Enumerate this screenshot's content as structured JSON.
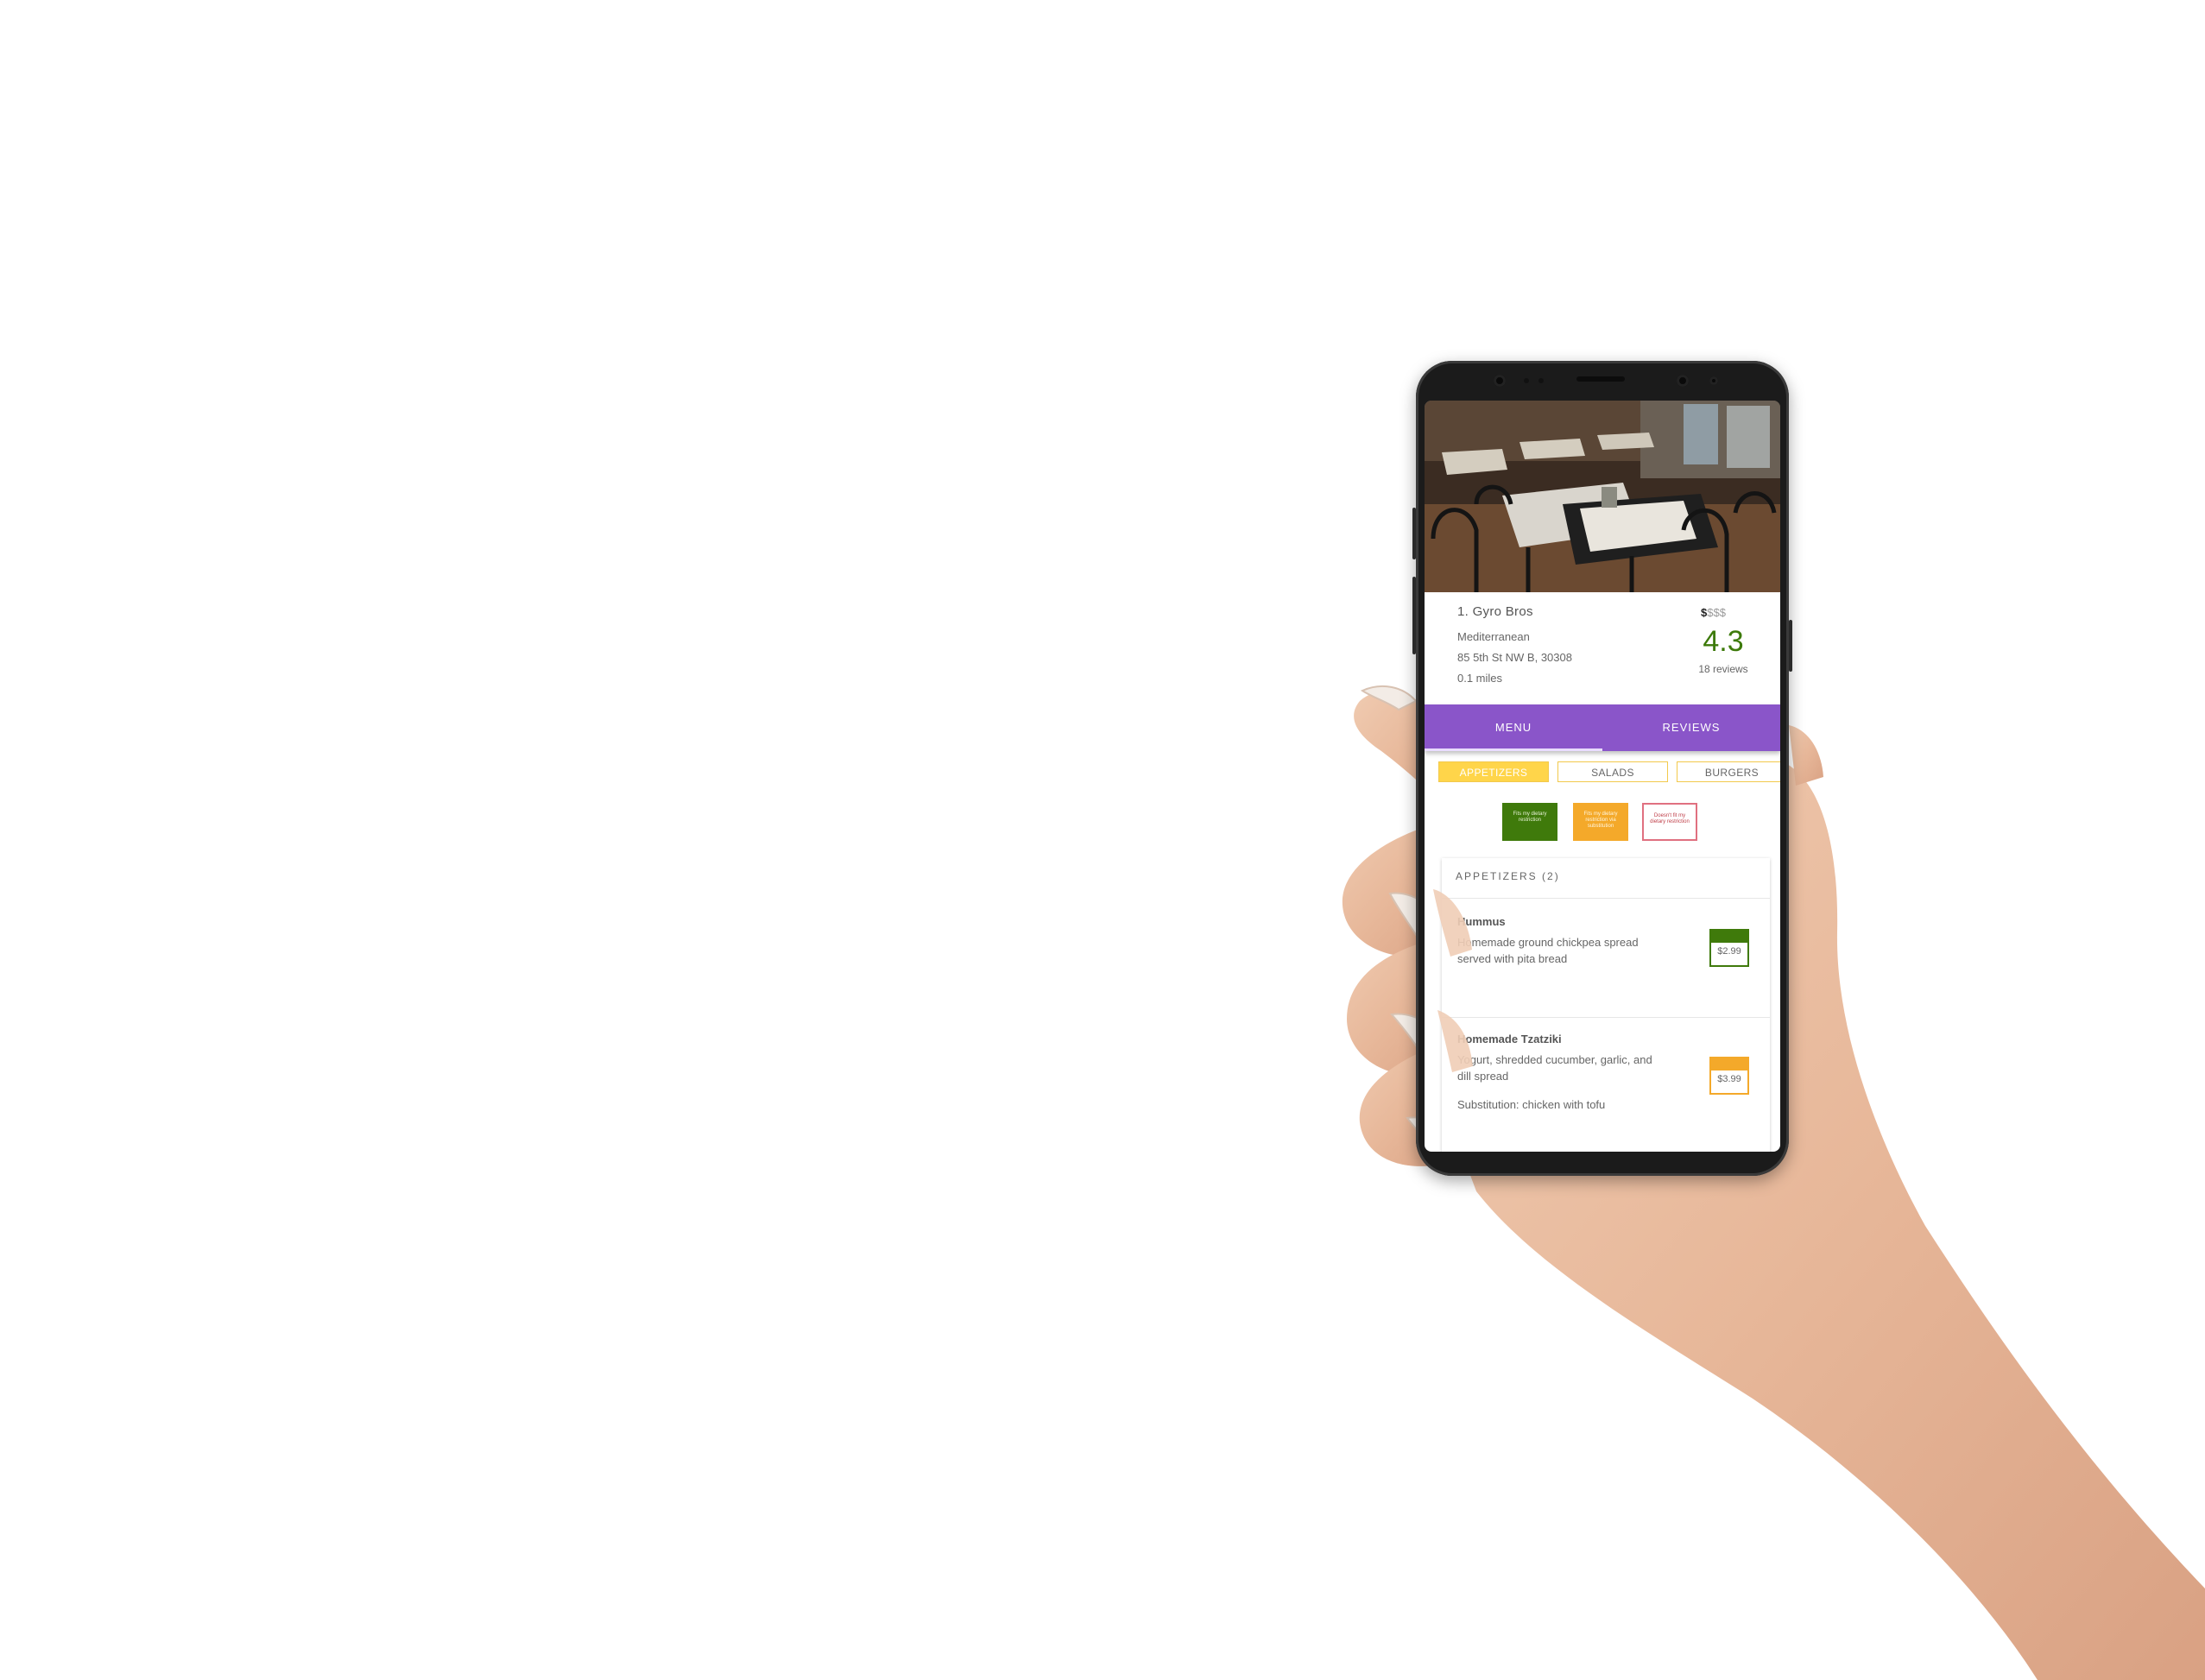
{
  "restaurant": {
    "name": "1. Gyro Bros",
    "cuisine": "Mediterranean",
    "address": "85 5th St NW B, 30308",
    "distance": "0.1 miles",
    "price_on": "$",
    "price_off": "$$$",
    "rating": "4.3",
    "reviews": "18 reviews"
  },
  "tabs": [
    {
      "label": "MENU",
      "active": true
    },
    {
      "label": "REVIEWS",
      "active": false
    }
  ],
  "categories": [
    {
      "label": "APPETIZERS",
      "active": true
    },
    {
      "label": "SALADS",
      "active": false
    },
    {
      "label": "BURGERS",
      "active": false
    }
  ],
  "legend": {
    "fits": "Fits my dietary restriction",
    "substitution": "Fits my dietary restriction via substitution",
    "doesnt_fit": "Doesn't fit my dietary restriction"
  },
  "menu": {
    "section_title": "APPETIZERS (2)",
    "items": [
      {
        "name": "Hummus",
        "description": "Homemade ground chickpea spread served with pita bread",
        "substitution": "",
        "price": "$2.99",
        "status_color": "#3f7a0b"
      },
      {
        "name": "Homemade Tzatziki",
        "description": "Yogurt, shredded cucumber, garlic, and dill spread",
        "substitution": "Substitution: chicken with tofu",
        "price": "$3.99",
        "status_color": "#f4a92a"
      }
    ]
  },
  "colors": {
    "tab_bar": "#8a55c9",
    "rating": "#3d7a0a",
    "chip_active": "#ffd54a"
  }
}
